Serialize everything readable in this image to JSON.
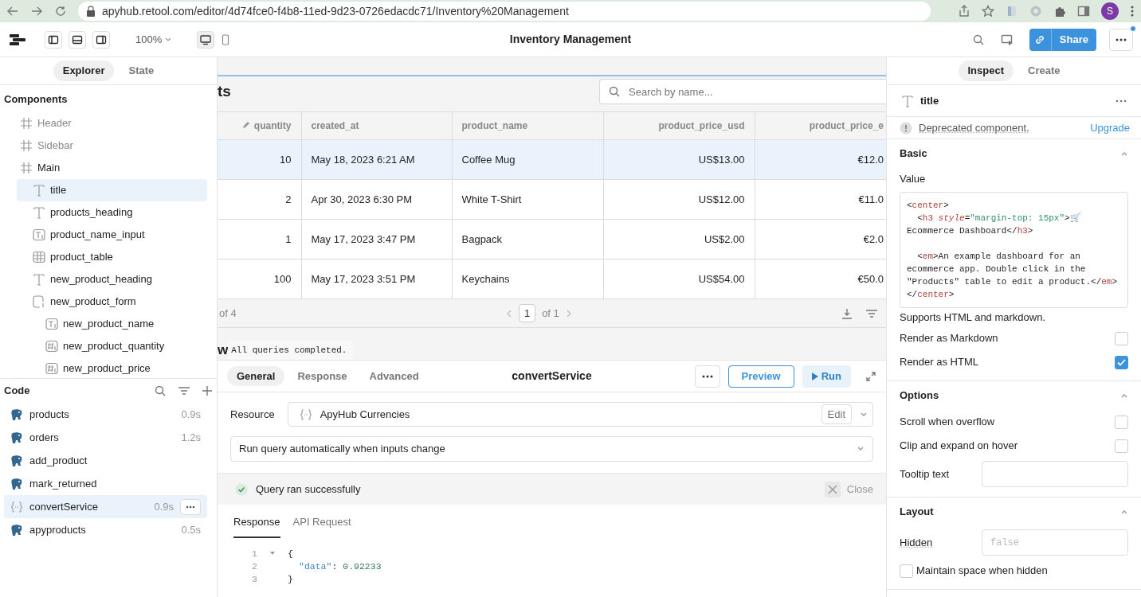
{
  "browser": {
    "url": "apyhub.retool.com/editor/4d74fce0-f4b8-11ed-9d23-0726edacdc71/Inventory%20Management",
    "profile_initial": "S"
  },
  "toolbar": {
    "zoom": "100%",
    "title": "Inventory Management",
    "share": "Share",
    "notification": true
  },
  "left_tabs": [
    {
      "label": "Explorer",
      "selected": true
    },
    {
      "label": "State",
      "selected": false
    }
  ],
  "components": {
    "heading": "Components",
    "tree": [
      {
        "label": "Header",
        "kind": "frame",
        "hidden": true,
        "selected": false
      },
      {
        "label": "Sidebar",
        "kind": "frame",
        "hidden": true,
        "selected": false
      },
      {
        "label": "Main",
        "kind": "frame",
        "hidden": false,
        "selected": false,
        "children": [
          {
            "label": "title",
            "kind": "text",
            "hidden": false,
            "selected": true
          },
          {
            "label": "products_heading",
            "kind": "text",
            "hidden": false,
            "selected": false
          },
          {
            "label": "product_name_input",
            "kind": "textinput",
            "hidden": false,
            "selected": false
          },
          {
            "label": "product_table",
            "kind": "table",
            "hidden": false,
            "selected": false
          },
          {
            "label": "new_product_heading",
            "kind": "text",
            "hidden": false,
            "selected": false
          },
          {
            "label": "new_product_form",
            "kind": "form",
            "hidden": false,
            "selected": false,
            "children": [
              {
                "label": "new_product_name",
                "kind": "textinput",
                "hidden": false,
                "selected": false
              },
              {
                "label": "new_product_quantity",
                "kind": "number",
                "hidden": false,
                "selected": false
              },
              {
                "label": "new_product_price",
                "kind": "number",
                "hidden": false,
                "selected": false
              }
            ]
          }
        ]
      }
    ]
  },
  "code": {
    "heading": "Code",
    "queries": [
      {
        "name": "products",
        "kind": "postgres",
        "time": "0.9s",
        "selected": false
      },
      {
        "name": "orders",
        "kind": "postgres",
        "time": "1.2s",
        "selected": false
      },
      {
        "name": "add_product",
        "kind": "postgres",
        "selected": false
      },
      {
        "name": "mark_returned",
        "kind": "postgres",
        "selected": false
      },
      {
        "name": "convertService",
        "kind": "rest",
        "time": "0.9s",
        "selected": true
      },
      {
        "name": "apyproducts",
        "kind": "postgres",
        "time": "0.5s",
        "selected": false
      }
    ]
  },
  "canvas": {
    "heading": "ts",
    "search": {
      "placeholder": "Search by name..."
    },
    "table": {
      "columns": [
        {
          "label": "quantity",
          "editable": true,
          "numeric": true
        },
        {
          "label": "created_at",
          "editable": false,
          "numeric": false
        },
        {
          "label": "product_name",
          "editable": false,
          "numeric": false
        },
        {
          "label": "product_price_usd",
          "editable": false,
          "numeric": true
        },
        {
          "label": "product_price_e",
          "editable": false,
          "numeric": true
        }
      ],
      "rows": [
        {
          "cells": [
            "10",
            "May 18, 2023 6:21 AM",
            "Coffee Mug",
            "US$13.00",
            "€12.0"
          ],
          "selected": true
        },
        {
          "cells": [
            "2",
            "Apr 30, 2023 6:30 PM",
            "White T-Shirt",
            "US$12.00",
            "€11.0"
          ],
          "selected": false
        },
        {
          "cells": [
            "1",
            "May 17, 2023 3:47 PM",
            "Bagpack",
            "US$2.00",
            "€2.0"
          ],
          "selected": false
        },
        {
          "cells": [
            "100",
            "May 17, 2023 3:51 PM",
            "Keychains",
            "US$54.00",
            "€50.0"
          ],
          "selected": false
        }
      ],
      "count": "of 4",
      "page": "1",
      "page_total": "of 1"
    },
    "form_heading": "w",
    "toast": "All queries completed."
  },
  "query": {
    "tabs": [
      {
        "label": "General",
        "selected": true
      },
      {
        "label": "Response",
        "selected": false
      },
      {
        "label": "Advanced",
        "selected": false
      }
    ],
    "name": "convertService",
    "preview": "Preview",
    "run": "Run",
    "resource_label": "Resource",
    "resource": "ApyHub Currencies",
    "edit": "Edit",
    "trigger": "Run query automatically when inputs change",
    "status": "Query ran successfully",
    "close": "Close",
    "result_tabs": [
      {
        "label": "Response",
        "selected": true
      },
      {
        "label": "API Request",
        "selected": false
      }
    ],
    "response_lines": [
      {
        "num": "1",
        "foldable": true,
        "indented": false,
        "tokens": [
          {
            "kind": "plain",
            "text": "{"
          }
        ]
      },
      {
        "num": "2",
        "foldable": false,
        "indented": true,
        "tokens": [
          {
            "kind": "key",
            "text": "\"data\""
          },
          {
            "kind": "plain",
            "text": ":"
          },
          {
            "kind": "number",
            "text": " 0.92233"
          }
        ]
      },
      {
        "num": "3",
        "foldable": false,
        "indented": false,
        "tokens": [
          {
            "kind": "plain",
            "text": "}"
          }
        ]
      }
    ]
  },
  "inspector": {
    "tabs": [
      {
        "label": "Inspect",
        "selected": true
      },
      {
        "label": "Create",
        "selected": false
      }
    ],
    "component": "title",
    "deprecated": "Deprecated component.",
    "upgrade": "Upgrade",
    "sections": [
      {
        "title": "Basic",
        "expanded": true,
        "rows": [
          {
            "kind": "label",
            "label": "Value"
          },
          {
            "kind": "code",
            "lines": [
              {
                "blank_before": false,
                "tokens": [
                  {
                    "kind": "plain",
                    "text": "<"
                  },
                  {
                    "kind": "tag",
                    "text": "center"
                  },
                  {
                    "kind": "plain",
                    "text": ">"
                  }
                ]
              },
              {
                "blank_before": false,
                "tokens": [
                  {
                    "kind": "plain",
                    "text": "  <"
                  },
                  {
                    "kind": "tag",
                    "text": "h3"
                  },
                  {
                    "kind": "attr",
                    "text": " style"
                  },
                  {
                    "kind": "plain",
                    "text": "="
                  },
                  {
                    "kind": "string",
                    "text": "\"margin-top: 15px\""
                  },
                  {
                    "kind": "plain",
                    "text": ">🛒"
                  }
                ]
              },
              {
                "blank_before": false,
                "tokens": [
                  {
                    "kind": "plain",
                    "text": "Ecommerce Dashboard</"
                  },
                  {
                    "kind": "tag",
                    "text": "h3"
                  },
                  {
                    "kind": "plain",
                    "text": ">"
                  }
                ]
              },
              {
                "blank_before": true,
                "tokens": [
                  {
                    "kind": "plain",
                    "text": "  <"
                  },
                  {
                    "kind": "tag",
                    "text": "em"
                  },
                  {
                    "kind": "plain",
                    "text": ">An example dashboard for an"
                  }
                ]
              },
              {
                "blank_before": false,
                "tokens": [
                  {
                    "kind": "plain",
                    "text": "ecommerce app. Double click in the"
                  }
                ]
              },
              {
                "blank_before": false,
                "tokens": [
                  {
                    "kind": "plain",
                    "text": "\"Products\" table to edit a product.</"
                  },
                  {
                    "kind": "tag",
                    "text": "em"
                  },
                  {
                    "kind": "plain",
                    "text": ">"
                  }
                ]
              },
              {
                "blank_before": false,
                "tokens": [
                  {
                    "kind": "plain",
                    "text": "</"
                  },
                  {
                    "kind": "tag",
                    "text": "center"
                  },
                  {
                    "kind": "plain",
                    "text": ">"
                  }
                ]
              }
            ]
          },
          {
            "kind": "help",
            "label": "Supports HTML and markdown."
          },
          {
            "kind": "checkbox",
            "label": "Render as Markdown",
            "checked": false
          },
          {
            "kind": "checkbox",
            "label": "Render as HTML",
            "checked": true
          }
        ]
      },
      {
        "title": "Options",
        "expanded": true,
        "rows": [
          {
            "kind": "checkbox",
            "label": "Scroll when overflow",
            "checked": false
          },
          {
            "kind": "checkbox",
            "label": "Clip and expand on hover",
            "checked": false
          },
          {
            "kind": "input",
            "label": "Tooltip text"
          }
        ]
      },
      {
        "title": "Layout",
        "expanded": true,
        "rows": [
          {
            "kind": "input",
            "label": "Hidden",
            "placeholder": "false"
          },
          {
            "kind": "checkbox_left",
            "label": "Maintain space when hidden",
            "checked": false
          }
        ]
      }
    ]
  }
}
